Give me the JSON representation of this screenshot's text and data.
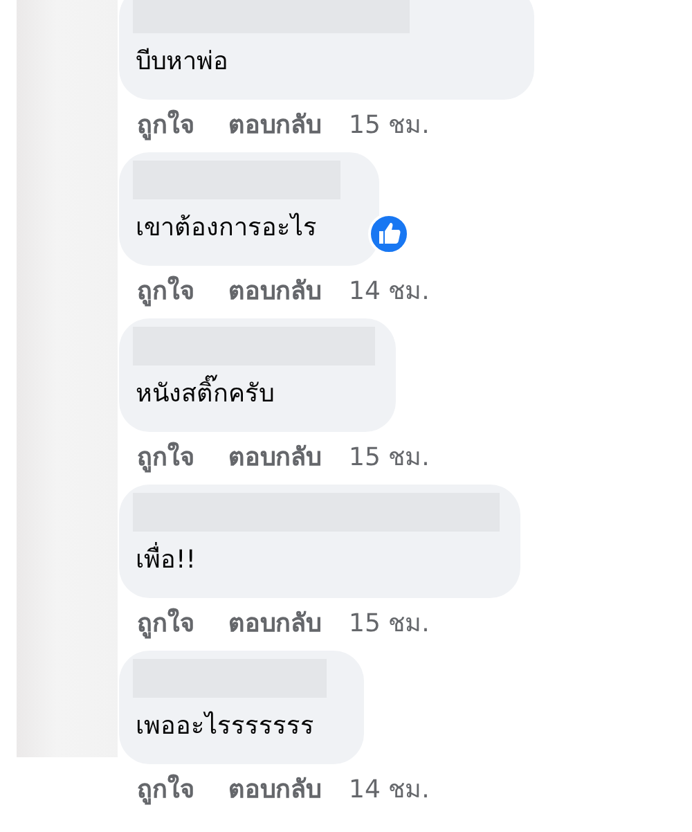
{
  "comments": [
    {
      "text": "บีบหาพ่อ",
      "liked": false,
      "like": "ถูกใจ",
      "reply": "ตอบกลับ",
      "time": "15 ชม."
    },
    {
      "text": "เขาต้องการอะไร",
      "liked": true,
      "like": "ถูกใจ",
      "reply": "ตอบกลับ",
      "time": "14 ชม."
    },
    {
      "text": "หนังสติ๊กครับ",
      "liked": false,
      "like": "ถูกใจ",
      "reply": "ตอบกลับ",
      "time": "15 ชม."
    },
    {
      "text": "เพื่อ!!",
      "liked": false,
      "like": "ถูกใจ",
      "reply": "ตอบกลับ",
      "time": "15 ชม."
    },
    {
      "text": "เพออะไรรรรรรร",
      "liked": false,
      "like": "ถูกใจ",
      "reply": "ตอบกลับ",
      "time": "14 ชม."
    }
  ]
}
